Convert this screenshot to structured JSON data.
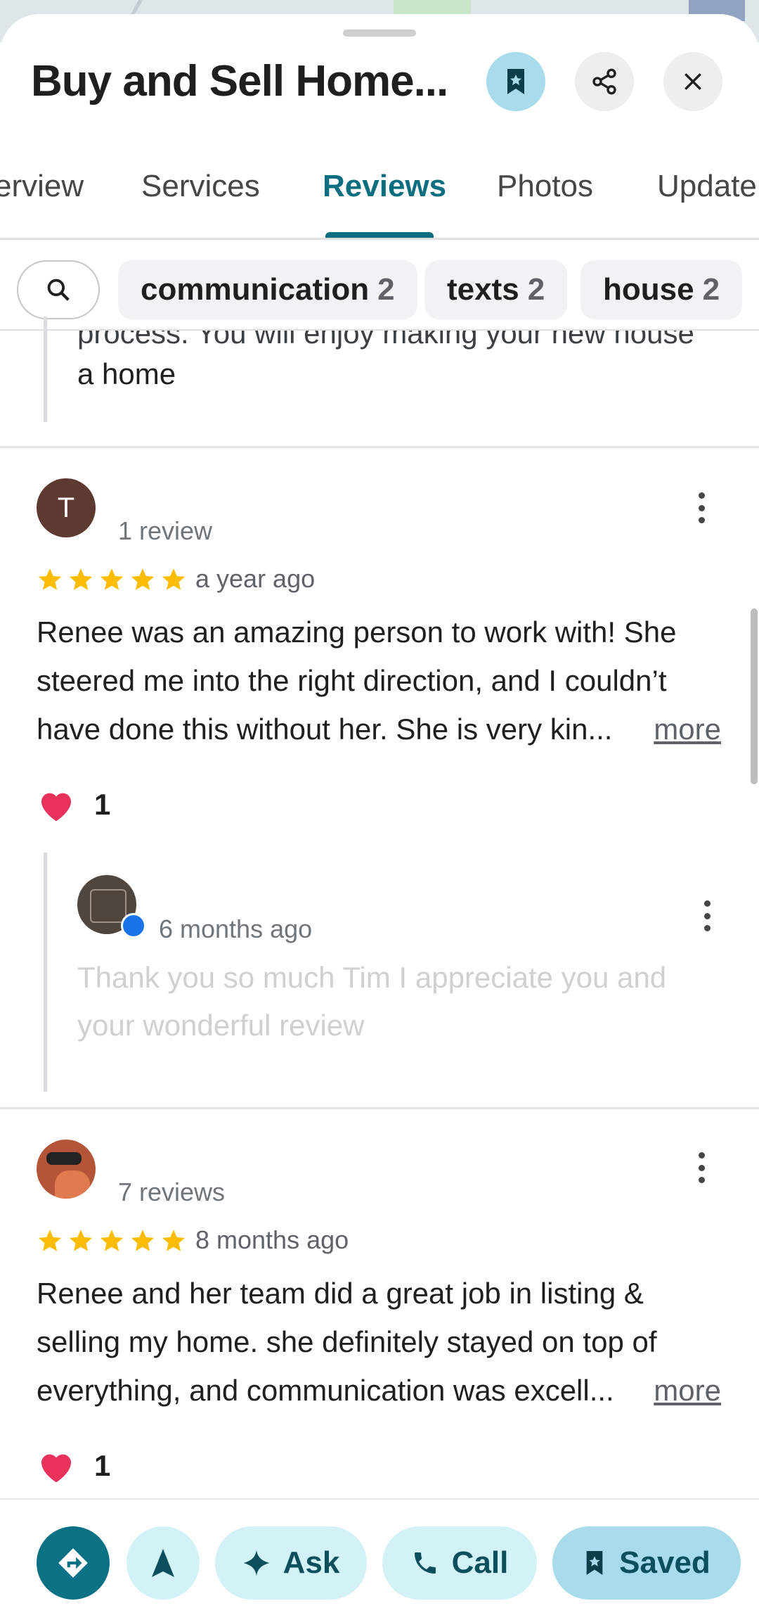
{
  "place": {
    "title": "Buy and Sell Home..."
  },
  "header": {
    "save_icon": "bookmark-icon",
    "share_icon": "share-icon",
    "close_icon": "close-icon"
  },
  "tabs": [
    {
      "label": "erview"
    },
    {
      "label": "Services"
    },
    {
      "label": "Reviews"
    },
    {
      "label": "Photos"
    },
    {
      "label": "Update"
    }
  ],
  "filters": {
    "chips": [
      {
        "label": "communication",
        "count": "2"
      },
      {
        "label": "texts",
        "count": "2"
      },
      {
        "label": "house",
        "count": "2"
      }
    ]
  },
  "prev_reply": {
    "line_cut": "process.  You will enjoy making your new house",
    "line_last": "a home"
  },
  "reviews": [
    {
      "avatar_letter": "T",
      "review_count": "1 review",
      "rating": 5,
      "time": "a year ago",
      "lines": [
        "Renee was an amazing person to work with! She",
        "steered me into the right direction, and I couldn’t",
        "have done this without her. She is very kin..."
      ],
      "more": "more",
      "likes": "1",
      "owner_reply": {
        "time": "6 months ago",
        "lines": [
          "Thank you so much Tim I appreciate you and",
          "your wonderful review"
        ]
      }
    },
    {
      "review_count": "7 reviews",
      "rating": 5,
      "time": "8 months ago",
      "lines": [
        "Renee and her team did a great job in listing &",
        "selling my home.  she definitely stayed on top of",
        "everything, and communication was excell..."
      ],
      "more": "more",
      "likes": "1"
    }
  ],
  "actions": {
    "ask": "Ask",
    "call": "Call",
    "saved": "Saved"
  },
  "colors": {
    "accent": "#0b6e80",
    "star": "#fbbc04",
    "heart": "#e8315b"
  }
}
